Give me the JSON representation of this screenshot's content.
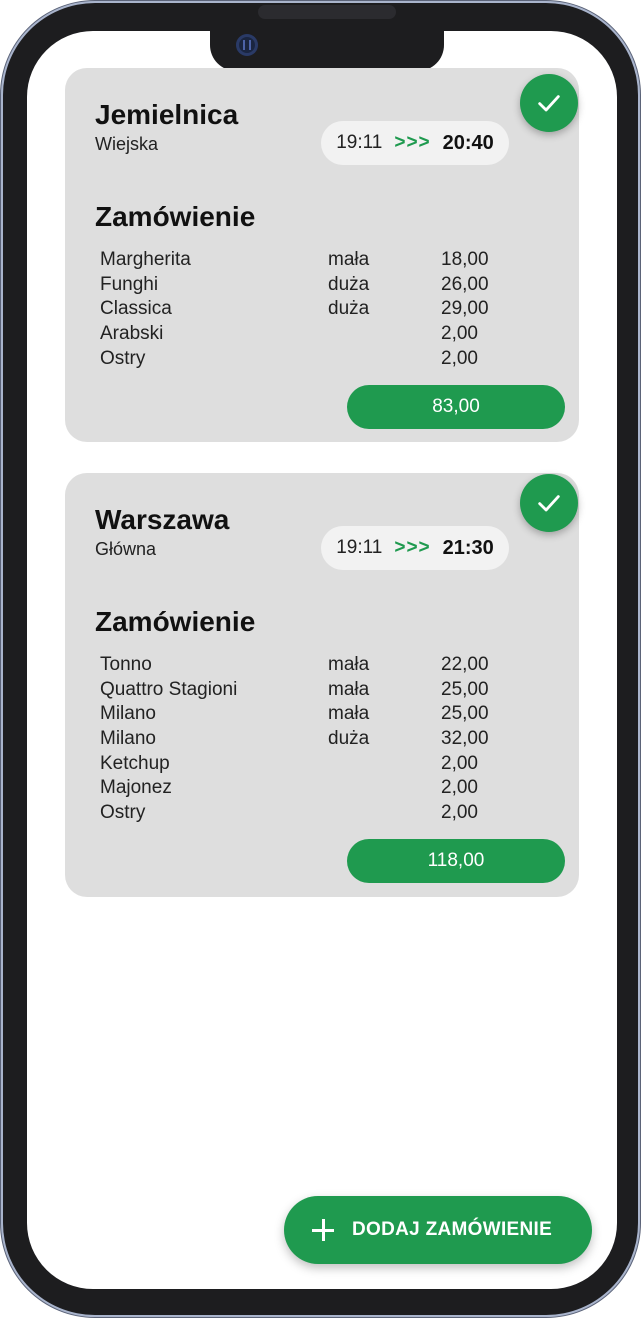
{
  "orders": [
    {
      "city": "Jemielnica",
      "street": "Wiejska",
      "time_start": "19:11",
      "arrows": ">>>",
      "time_end": "20:40",
      "section_title": "Zamówienie",
      "items": [
        {
          "name": "Margherita",
          "size": "mała",
          "price": "18,00"
        },
        {
          "name": "Funghi",
          "size": "duża",
          "price": "26,00"
        },
        {
          "name": "Classica",
          "size": "duża",
          "price": "29,00"
        },
        {
          "name": "Arabski",
          "size": "",
          "price": "2,00"
        },
        {
          "name": "Ostry",
          "size": "",
          "price": "2,00"
        }
      ],
      "total": "83,00",
      "completed": true
    },
    {
      "city": "Warszawa",
      "street": "Główna",
      "time_start": "19:11",
      "arrows": ">>>",
      "time_end": "21:30",
      "section_title": "Zamówienie",
      "items": [
        {
          "name": "Tonno",
          "size": "mała",
          "price": "22,00"
        },
        {
          "name": "Quattro Stagioni",
          "size": "mała",
          "price": "25,00"
        },
        {
          "name": "Milano",
          "size": "mała",
          "price": "25,00"
        },
        {
          "name": "Milano",
          "size": "duża",
          "price": "32,00"
        },
        {
          "name": "Ketchup",
          "size": "",
          "price": "2,00"
        },
        {
          "name": "Majonez",
          "size": "",
          "price": "2,00"
        },
        {
          "name": "Ostry",
          "size": "",
          "price": "2,00"
        }
      ],
      "total": "118,00",
      "completed": true
    }
  ],
  "fab": {
    "label": "DODAJ ZAMÓWIENIE",
    "icon": "plus-icon"
  },
  "colors": {
    "accent": "#1f9a4f",
    "card": "#dedede",
    "pill": "#f2f2f2"
  }
}
